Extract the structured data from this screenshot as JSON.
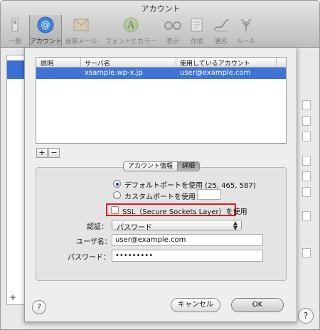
{
  "window": {
    "title": "アカウント"
  },
  "toolbar": {
    "items": [
      {
        "label": "一般",
        "icon": "switch-icon"
      },
      {
        "label": "アカウント",
        "icon": "at-sign-icon"
      },
      {
        "label": "迷惑メール",
        "icon": "junk-mail-icon"
      },
      {
        "label": "フォントとカラー",
        "icon": "fonts-colors-icon"
      },
      {
        "label": "表示",
        "icon": "glasses-icon"
      },
      {
        "label": "作成",
        "icon": "compose-icon"
      },
      {
        "label": "署名",
        "icon": "signature-icon"
      },
      {
        "label": "ルール",
        "icon": "rules-icon"
      }
    ],
    "selected": "アカウント"
  },
  "background": {
    "plus_label": "+",
    "help_label": "?"
  },
  "server_table": {
    "columns": [
      "説明",
      "サーバ名",
      "使用しているアカウント"
    ],
    "rows": [
      {
        "description": "",
        "server": "xsample.wp-x.jp",
        "account": "user@example.com"
      }
    ]
  },
  "table_buttons": {
    "add": "+",
    "remove": "−"
  },
  "tabs": {
    "info": "アカウント情報",
    "advanced": "詳細",
    "active": "詳細"
  },
  "port": {
    "default_label": "デフォルトポートを使用 (25, 465, 587)",
    "custom_label": "カスタムポートを使用：",
    "custom_value": ""
  },
  "ssl": {
    "label": "SSL（Secure Sockets Layer）を使用",
    "checked": false
  },
  "auth": {
    "label": "認証：",
    "value": "パスワード"
  },
  "username": {
    "label": "ユーザ名：",
    "value": "user@example.com"
  },
  "password": {
    "label": "パスワード：",
    "value": "•••••••••"
  },
  "buttons": {
    "help": "?",
    "cancel": "キャンセル",
    "ok": "OK"
  },
  "colors": {
    "selection": "#3f74d6",
    "highlight_border": "#e01919"
  }
}
